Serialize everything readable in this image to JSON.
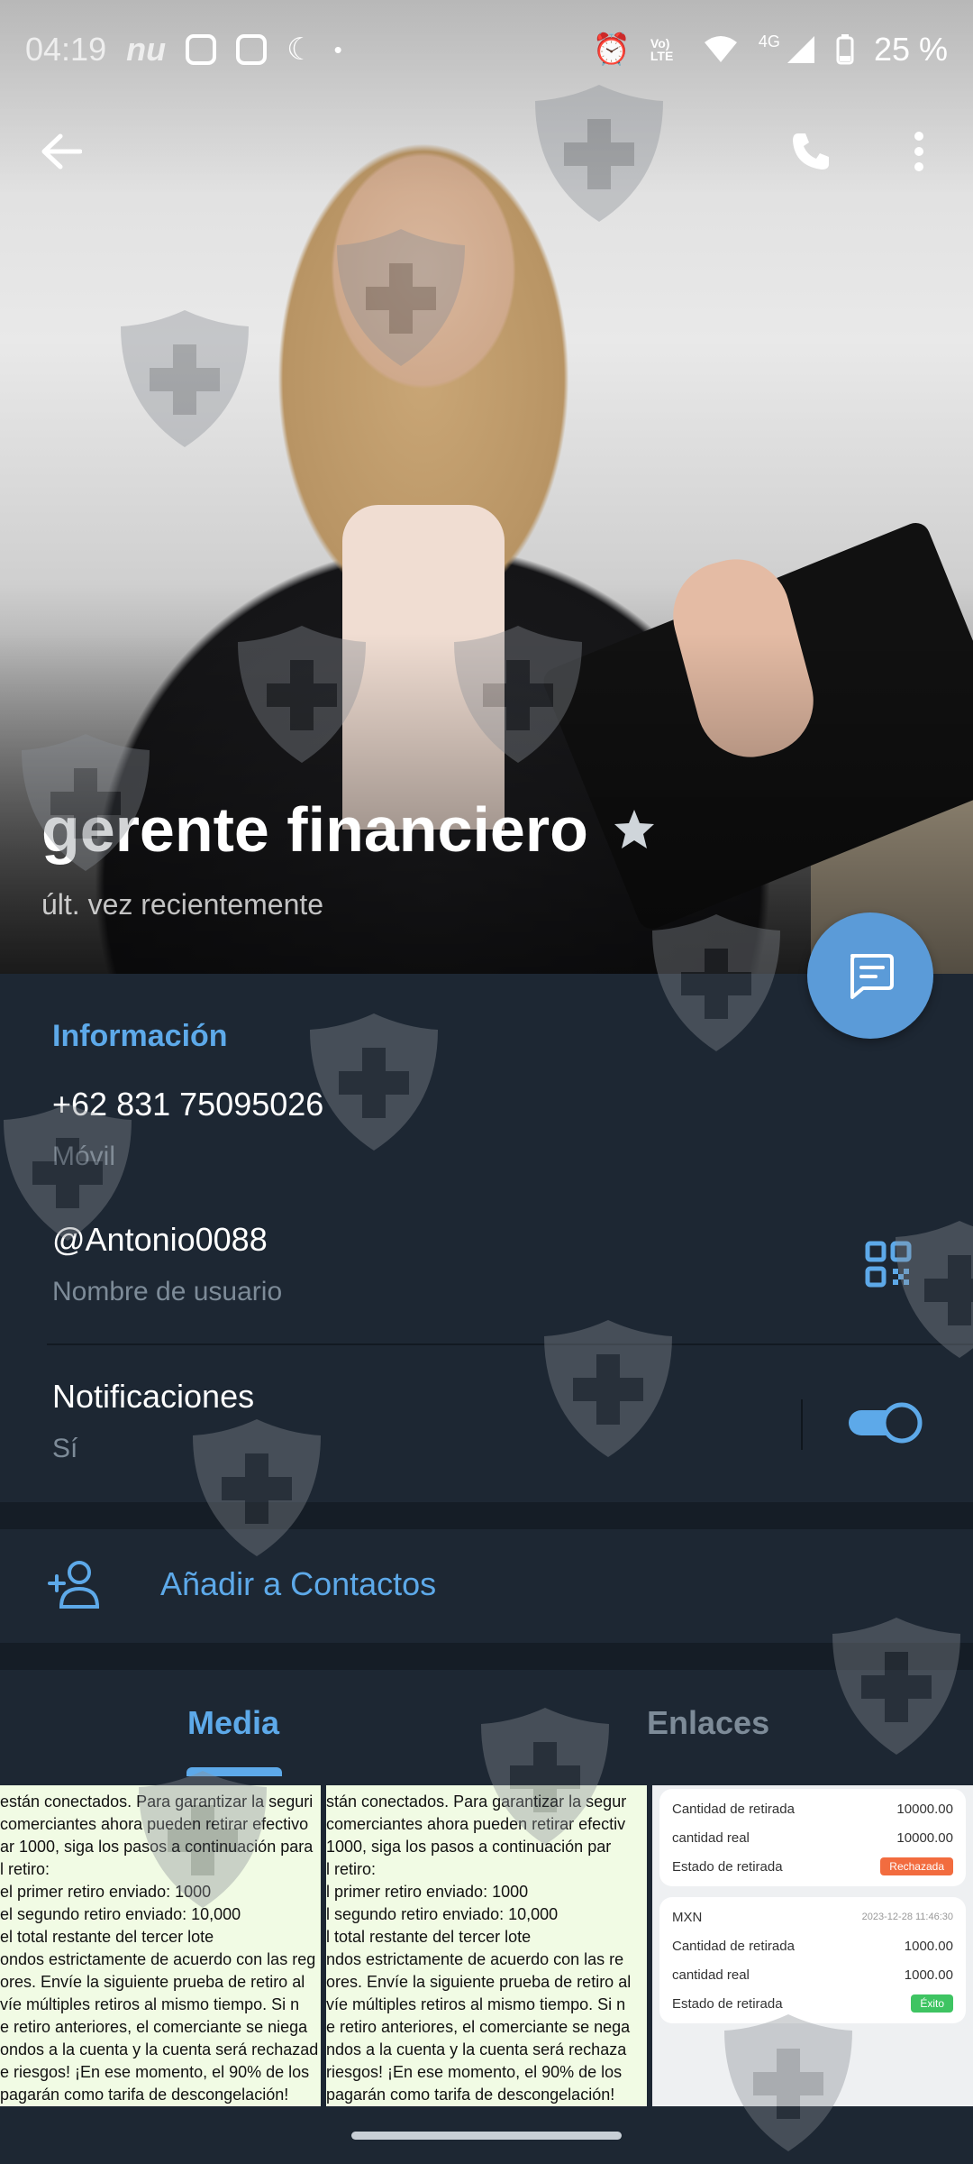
{
  "status_bar": {
    "time": "04:19",
    "carrier_text": "nu",
    "network_label": "4G",
    "volte_label": "Vo) LTE",
    "battery": "25 %"
  },
  "profile": {
    "name": "gerente financiero",
    "last_seen": "últ. vez recientemente"
  },
  "info": {
    "section_title": "Información",
    "phone": "+62 831 75095026",
    "phone_label": "Móvil",
    "username": "@Antonio0088",
    "username_label": "Nombre de usuario",
    "notifications": "Notificaciones",
    "notifications_value": "Sí",
    "notifications_enabled": true
  },
  "add_contact": {
    "label": "Añadir a Contactos"
  },
  "tabs": [
    {
      "label": "Media",
      "active": true
    },
    {
      "label": "Enlaces",
      "active": false
    }
  ],
  "media": {
    "thumb1_lines": [
      "están conectados. Para garantizar la seguri",
      "comerciantes ahora pueden retirar efectivo",
      "ar 1000, siga los pasos a continuación para",
      "l retiro:",
      "el primer retiro enviado: 1000",
      "el segundo retiro enviado: 10,000",
      "el total restante del tercer lote",
      "ondos estrictamente de acuerdo con las reg",
      "ores. Envíe la siguiente prueba de retiro al",
      "víe múltiples retiros al mismo tiempo. Si n",
      "e retiro anteriores, el comerciante se niega",
      "ondos a la cuenta y la cuenta será rechazad",
      "e riesgos! ¡En ese momento, el 90% de los",
      "pagarán como tarifa de descongelación!"
    ],
    "thumb2_lines": [
      "stán conectados. Para garantizar la segur",
      "comerciantes ahora pueden retirar efectiv",
      "1000, siga los pasos a continuación par",
      "l retiro:",
      "l primer retiro enviado: 1000",
      "l segundo retiro enviado: 10,000",
      "l total restante del tercer lote",
      "ndos estrictamente de acuerdo con las re",
      "ores. Envíe la siguiente prueba de retiro al",
      "víe múltiples retiros al mismo tiempo. Si n",
      "e retiro anteriores, el comerciante se nega",
      "ndos a la cuenta y la cuenta será rechaza",
      "riesgos! ¡En ese momento, el 90% de los",
      "pagarán como tarifa de descongelación!"
    ],
    "thumb3": {
      "card1": {
        "rows": [
          {
            "label": "Cantidad de retirada",
            "value": "10000.00"
          },
          {
            "label": "cantidad real",
            "value": "10000.00"
          },
          {
            "label": "Estado de retirada",
            "value": "Rechazada"
          }
        ]
      },
      "card2": {
        "currency": "MXN",
        "date": "2023-12-28 11:46:30",
        "rows": [
          {
            "label": "Cantidad de retirada",
            "value": "1000.00"
          },
          {
            "label": "cantidad real",
            "value": "1000.00"
          },
          {
            "label": "Estado de retirada",
            "value": "Éxito"
          }
        ]
      }
    }
  },
  "colors": {
    "background": "#1d2733",
    "accent": "#5da9e9",
    "fab": "#5b9bd8",
    "secondary_text": "#7d8b98"
  }
}
